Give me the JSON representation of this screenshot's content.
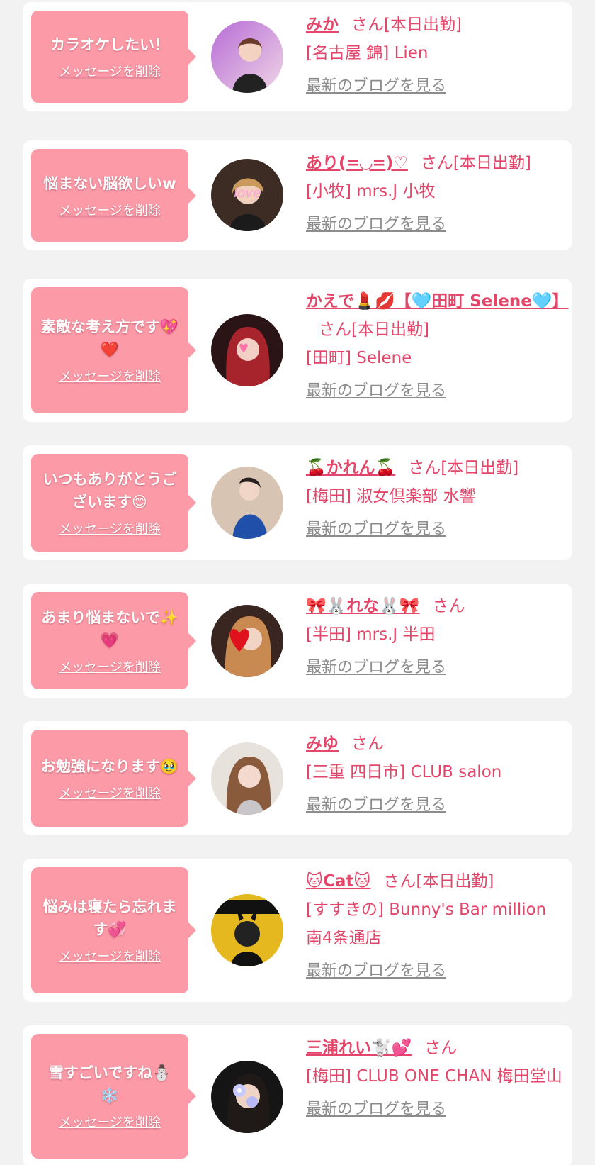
{
  "labels": {
    "delete_message": "メッセージを削除",
    "latest_blog": "最新のブログを見る",
    "san": "さん"
  },
  "colors": {
    "page_background": "#f2f2f2",
    "bubble": "#fc9aa7",
    "accent_text": "#e4466a",
    "blog_link": "#8c8c8c"
  },
  "messages": [
    {
      "message": "カラオケしたい！",
      "name": "みか",
      "status": "さん[本日出勤]",
      "store": "[名古屋 錦] Lien"
    },
    {
      "message": "悩まない脳欲しいw",
      "name": "あり(=◡=)♡",
      "status": "さん[本日出勤]",
      "store": "[小牧] mrs.J 小牧"
    },
    {
      "message": "素敵な考え方です💖❤️",
      "name": "かえで💄💋【🩵田町 Selene🩵】",
      "status": "さん[本日出勤]",
      "store": "[田町] Selene"
    },
    {
      "message": "いつもありがとうございます😊",
      "name": "🍒かれん🍒",
      "status": "さん[本日出勤]",
      "store": "[梅田] 淑女倶楽部 水響"
    },
    {
      "message": "あまり悩まないで✨💗",
      "name": "🎀🐰れな🐰🎀",
      "status": "さん",
      "store": "[半田] mrs.J 半田"
    },
    {
      "message": "お勉強になります🥹",
      "name": "みゆ",
      "status": "さん",
      "store": "[三重 四日市] CLUB salon"
    },
    {
      "message": "悩みは寝たら忘れます💞",
      "name": "🐱Cat🐱",
      "status": "さん[本日出勤]",
      "store": "[すすきの] Bunny's Bar million 南4条通店"
    },
    {
      "message": "雪すごいですね⛄❄️",
      "name": "三浦れい🐩💕",
      "status": "さん",
      "store": "[梅田] CLUB ONE CHAN 梅田堂山"
    }
  ]
}
